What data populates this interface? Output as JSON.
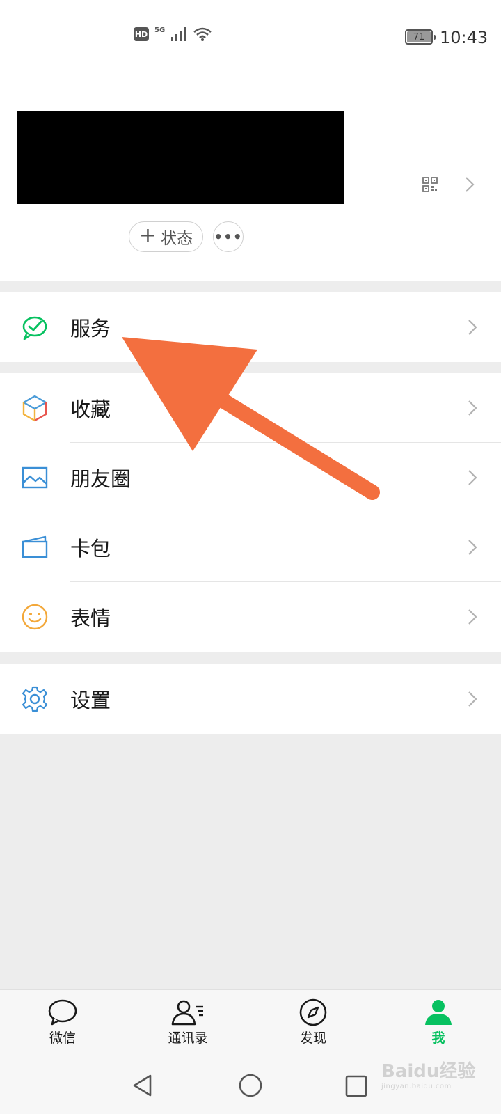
{
  "status_bar": {
    "hd": "HD",
    "network": "5G",
    "battery": "71",
    "time": "10:43"
  },
  "profile": {
    "status_button": "状态",
    "more_button": "•••"
  },
  "menu": {
    "services": "服务",
    "favorites": "收藏",
    "moments": "朋友圈",
    "cards": "卡包",
    "stickers": "表情",
    "settings": "设置"
  },
  "bottom_nav": {
    "chats": "微信",
    "contacts": "通讯录",
    "discover": "发现",
    "me": "我",
    "active": "me"
  },
  "watermark": {
    "brand": "Baidu经验",
    "url": "jingyan.baidu.com"
  },
  "colors": {
    "accent": "#07c160",
    "arrow": "#f36f3f",
    "background": "#ededed"
  }
}
